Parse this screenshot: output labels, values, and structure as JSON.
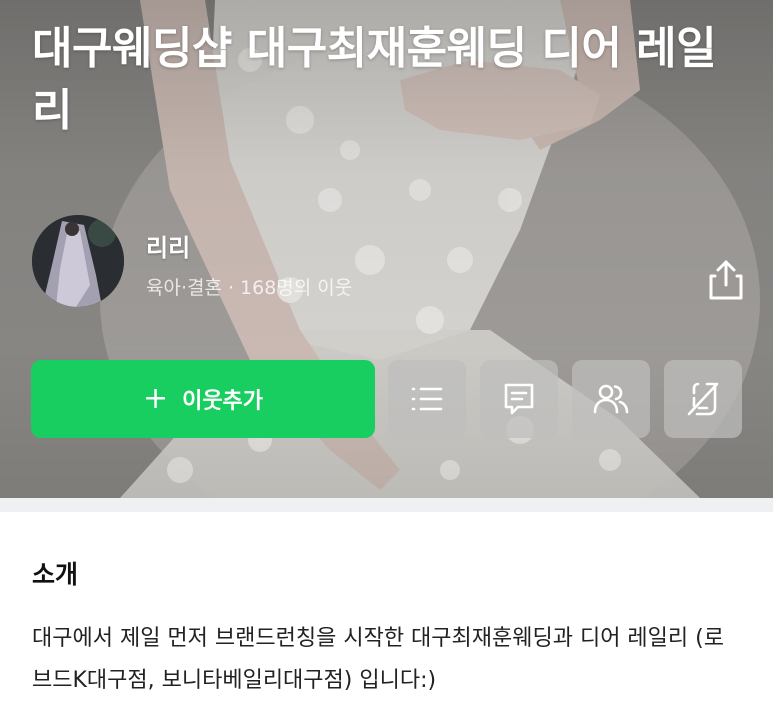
{
  "blog": {
    "title": "대구웨딩샵 대구최재훈웨딩 디어 레일리"
  },
  "owner": {
    "name": "리리",
    "category": "육아·결혼",
    "separator": "·",
    "neighbors": "168명의 이웃"
  },
  "actions": {
    "follow_plus": "+",
    "follow_label": "이웃추가",
    "share_icon": "share-icon",
    "list_icon": "list-icon",
    "post_icon": "message-icon",
    "neighbor_icon": "users-icon",
    "notification_icon": "notification-off-icon"
  },
  "intro": {
    "heading": "소개",
    "text": "대구에서 제일 먼저 브랜드런칭을 시작한 대구최재훈웨딩과 디어 레일리 (로브드K대구점, 보니타베일리대구점) 입니다:)"
  },
  "colors": {
    "follow_green": "#19ce60",
    "action_gray": "#bebebc",
    "divider": "#eef0f2"
  }
}
